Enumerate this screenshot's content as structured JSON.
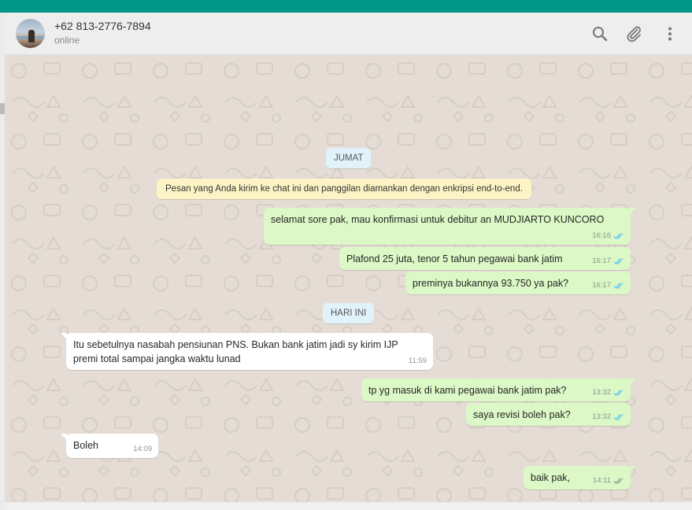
{
  "header": {
    "contact_name": "+62 813-2776-7894",
    "status": "online",
    "icons": [
      "search-icon",
      "attach-icon",
      "menu-icon"
    ]
  },
  "chat": {
    "day_label_1": "JUMAT",
    "encryption_notice": "Pesan yang Anda kirim ke chat ini dan panggilan diamankan dengan enkripsi end-to-end.",
    "day_label_2": "HARI INI",
    "messages": [
      {
        "direction": "out",
        "text": "selamat sore pak, mau konfirmasi untuk debitur an MUDJIARTO KUNCORO",
        "time": "16:16",
        "status": "read"
      },
      {
        "direction": "out",
        "text": "Plafond 25 juta, tenor 5 tahun pegawai bank jatim",
        "time": "16:17",
        "status": "read"
      },
      {
        "direction": "out",
        "text": "preminya bukannya 93.750 ya pak?",
        "time": "16:17",
        "status": "read"
      },
      {
        "direction": "in",
        "text": "Itu sebetulnya nasabah pensiunan PNS. Bukan bank jatim jadi sy kirim IJP premi total sampai jangka waktu lunad",
        "time": "11:59"
      },
      {
        "direction": "out",
        "text": "tp yg masuk di kami pegawai bank jatim pak?",
        "time": "13:32",
        "status": "read"
      },
      {
        "direction": "out",
        "text": "saya revisi boleh pak?",
        "time": "13:32",
        "status": "read"
      },
      {
        "direction": "in",
        "text": "Boleh",
        "time": "14:09"
      },
      {
        "direction": "out",
        "text": "baik pak,",
        "time": "14:11",
        "status": "delivered"
      }
    ]
  },
  "colors": {
    "brand_bar": "#009688",
    "outgoing_bubble": "#dcf8c6",
    "incoming_bubble": "#ffffff",
    "read_tick": "#4fc3f7",
    "delivered_tick": "#8c968c",
    "notice_bg": "#fdf4c5",
    "day_chip_bg": "#e1f2fb"
  }
}
